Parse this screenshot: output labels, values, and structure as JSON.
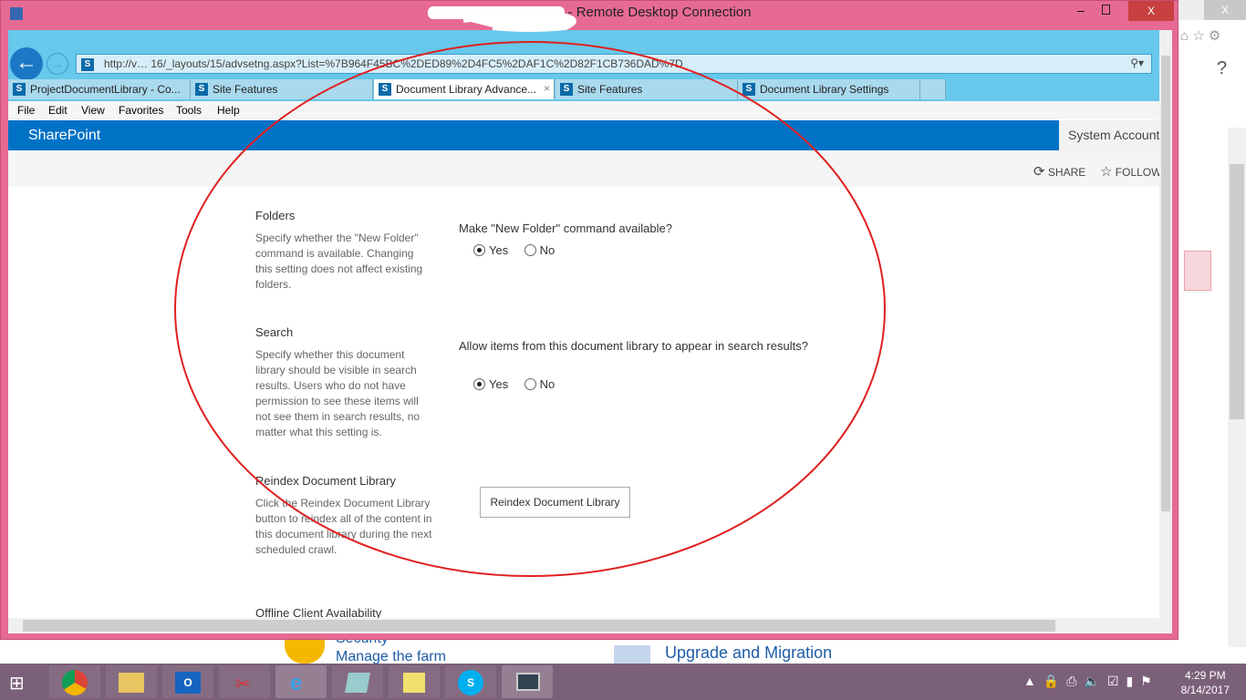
{
  "window": {
    "title": "- Remote Desktop Connection"
  },
  "browser": {
    "url": "http://v… 16/_layouts/15/advsetng.aspx?List=%7B964F45BC%2DED89%2D4FC5%2DAF1C%2D82F1CB736DAD%7D",
    "tabs": [
      {
        "label": "ProjectDocumentLibrary - Co..."
      },
      {
        "label": "Site Features"
      },
      {
        "label": "Document Library Advance..."
      },
      {
        "label": "Site Features"
      },
      {
        "label": "Document Library Settings"
      }
    ],
    "menu": [
      "File",
      "Edit",
      "View",
      "Favorites",
      "Tools",
      "Help"
    ]
  },
  "sharepoint": {
    "brand": "SharePoint",
    "account": "System Account",
    "share": "SHARE",
    "follow": "FOLLOW"
  },
  "sections": [
    {
      "title": "Folders",
      "desc": "Specify whether the \"New Folder\" command is available. Changing this setting does not affect existing folders.",
      "question": "Make \"New Folder\" command available?",
      "options": [
        "Yes",
        "No"
      ],
      "selected": "Yes"
    },
    {
      "title": "Search",
      "desc": "Specify whether this document library should be visible in search results. Users who do not have permission to see these items will not see them in search results, no matter what this setting is.",
      "question": "Allow items from this document library to appear in search results?",
      "options": [
        "Yes",
        "No"
      ],
      "selected": "Yes"
    },
    {
      "title": "Reindex Document Library",
      "desc": "Click the Reindex Document Library button to reindex all of the content in this document library during the next scheduled crawl.",
      "button": "Reindex Document Library"
    },
    {
      "title": "Offline Client Availability"
    }
  ],
  "host": {
    "security": "Security",
    "manage_farm": "Manage the farm",
    "upgrade": "Upgrade and Migration"
  },
  "taskbar": {
    "time": "4:29 PM",
    "date": "8/14/2017"
  },
  "colors": {
    "rdp_frame": "#e76a92",
    "sharepoint_blue": "#0072c6",
    "ie_chrome": "#66c8ea",
    "annotation": "#e02020"
  }
}
